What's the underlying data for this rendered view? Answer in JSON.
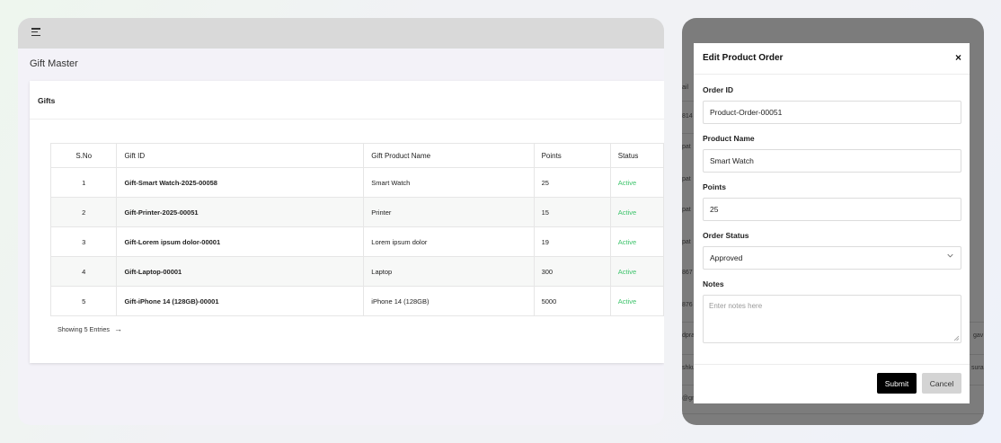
{
  "page": {
    "title": "Gift Master"
  },
  "card": {
    "title": "Gifts"
  },
  "table": {
    "headers": [
      "S.No",
      "Gift ID",
      "Gift Product Name",
      "Points",
      "Status"
    ],
    "rows": [
      [
        "1",
        "Gift-Smart Watch-2025-00058",
        "Smart Watch",
        "25",
        "Active"
      ],
      [
        "2",
        "Gift-Printer-2025-00051",
        "Printer",
        "15",
        "Active"
      ],
      [
        "3",
        "Gift-Lorem ipsum dolor-00001",
        "Lorem ipsum dolor",
        "19",
        "Active"
      ],
      [
        "4",
        "Gift-Laptop-00001",
        "Laptop",
        "300",
        "Active"
      ],
      [
        "5",
        "Gift-iPhone 14 (128GB)-00001",
        "iPhone 14 (128GB)",
        "5000",
        "Active"
      ]
    ]
  },
  "pagination": {
    "text": "Showing 5 Entries",
    "arrow": "→"
  },
  "background_fragments": [
    "ail",
    "814",
    "pat",
    "pat",
    "pat",
    "pat",
    "867",
    "876",
    "dpra",
    "gav",
    "shku",
    "sura",
    "@gm"
  ],
  "modal": {
    "title": "Edit Product Order",
    "close_label": "×",
    "fields": {
      "order_id": {
        "label": "Order ID",
        "value": "Product-Order-00051"
      },
      "product_name": {
        "label": "Product Name",
        "value": "Smart Watch"
      },
      "points": {
        "label": "Points",
        "value": "25"
      },
      "order_status": {
        "label": "Order Status",
        "value": "Approved"
      },
      "notes": {
        "label": "Notes",
        "placeholder": "Enter notes here"
      }
    },
    "submit_label": "Submit",
    "cancel_label": "Cancel"
  },
  "colors": {
    "active_status": "#3cc36a",
    "submit_bg": "#000000",
    "cancel_bg": "#d4d4d4"
  }
}
